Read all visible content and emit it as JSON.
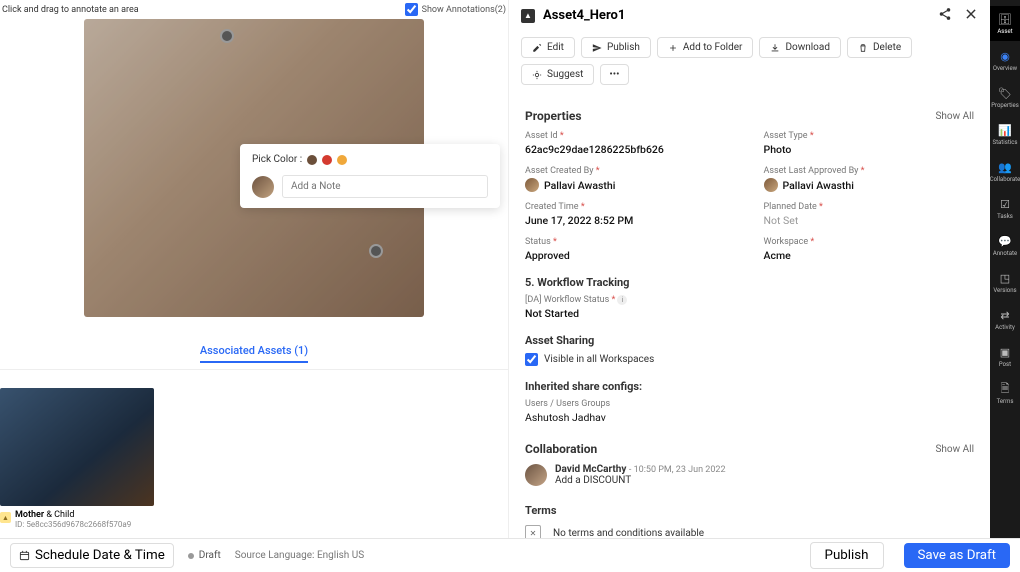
{
  "left": {
    "hint": "Click and drag to annotate an area",
    "show_annotations_label": "Show Annotations(2)",
    "note": {
      "pick_label": "Pick Color :",
      "swatches": [
        "#6b4f3a",
        "#d43a2f",
        "#f0a83a"
      ],
      "placeholder": "Add a Note"
    },
    "tab_label": "Associated Assets (1)",
    "thumb": {
      "title_bold": "Mother",
      "title_rest": " & Child",
      "id_label": "ID: 5e8cc356d9678c2668f570a9"
    }
  },
  "right": {
    "title": "Asset4_Hero1",
    "toolbar": {
      "edit": "Edit",
      "publish": "Publish",
      "add": "Add to Folder",
      "download": "Download",
      "delete": "Delete",
      "suggest": "Suggest"
    },
    "sections": {
      "properties": {
        "title": "Properties",
        "show_all": "Show All"
      },
      "workflow": {
        "title": "5. Workflow Tracking"
      },
      "sharing": {
        "title": "Asset Sharing"
      },
      "inherited": {
        "title": "Inherited share configs:"
      },
      "collab": {
        "title": "Collaboration",
        "show_all": "Show All"
      },
      "terms": {
        "title": "Terms",
        "empty": "No terms and conditions available"
      }
    },
    "props": {
      "asset_id": {
        "label": "Asset Id",
        "value": "62ac9c29dae1286225bfb626"
      },
      "asset_type": {
        "label": "Asset Type",
        "value": "Photo"
      },
      "created_by": {
        "label": "Asset Created By",
        "value": "Pallavi Awasthi"
      },
      "approved_by": {
        "label": "Asset Last Approved By",
        "value": "Pallavi Awasthi"
      },
      "created_time": {
        "label": "Created Time",
        "value": "June 17, 2022 8:52 PM"
      },
      "planned_date": {
        "label": "Planned Date",
        "value": "Not Set"
      },
      "status": {
        "label": "Status",
        "value": "Approved"
      },
      "workspace": {
        "label": "Workspace",
        "value": "Acme"
      },
      "wf_status": {
        "label": "[DA] Workflow Status",
        "value": "Not Started"
      }
    },
    "sharing": {
      "visible_label": "Visible in all Workspaces",
      "users_label": "Users / Users Groups",
      "user_value": "Ashutosh Jadhav"
    },
    "collab": {
      "name": "David McCarthy",
      "time": "10:50 PM, 23 Jun 2022",
      "msg": "Add a DISCOUNT"
    }
  },
  "sidebar": {
    "items": [
      {
        "label": "Asset"
      },
      {
        "label": "Overview"
      },
      {
        "label": "Properties"
      },
      {
        "label": "Statistics"
      },
      {
        "label": "Collaborate"
      },
      {
        "label": "Tasks"
      },
      {
        "label": "Annotate"
      },
      {
        "label": "Versions"
      },
      {
        "label": "Activity"
      },
      {
        "label": "Post"
      },
      {
        "label": "Terms"
      }
    ]
  },
  "bottom": {
    "schedule": "Schedule Date & Time",
    "draft": "Draft",
    "src_lang": "Source Language: English US",
    "publish": "Publish",
    "save": "Save as Draft"
  }
}
